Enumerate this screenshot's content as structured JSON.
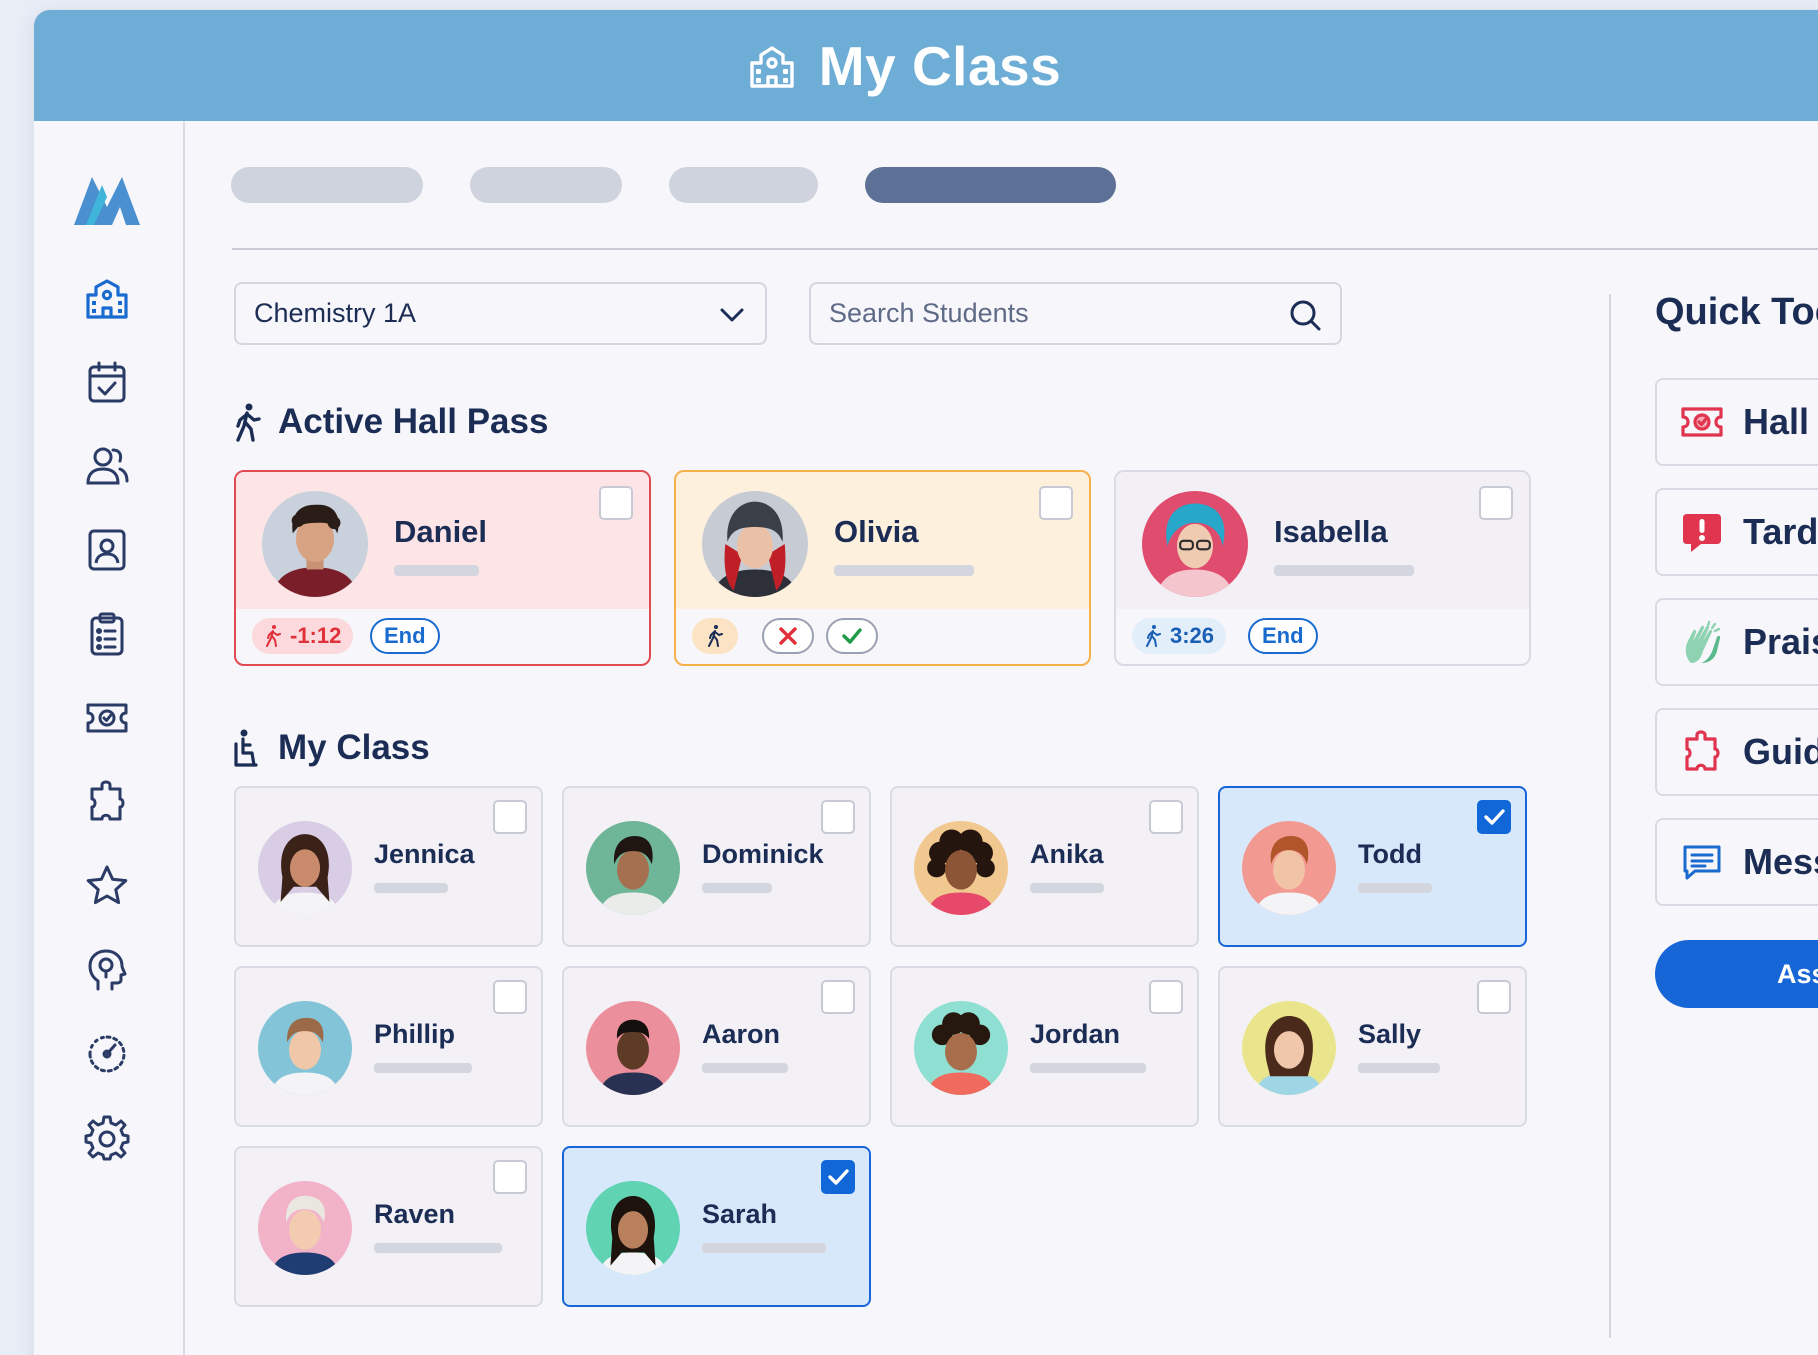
{
  "header": {
    "title": "My Class"
  },
  "sidebar": {
    "icons": [
      "logo-icon",
      "school-icon",
      "calendar-check-icon",
      "users-icon",
      "id-card-icon",
      "clipboard-icon",
      "ticket-icon",
      "puzzle-icon",
      "star-icon",
      "head-icon",
      "gauge-icon",
      "gear-icon"
    ]
  },
  "filters": {
    "class_value": "Chemistry 1A",
    "search_placeholder": "Search Students"
  },
  "hall_pass": {
    "title": "Active Hall Pass",
    "cards": [
      {
        "name": "Daniel",
        "status": "overdue",
        "time": "-1:12",
        "action": "End",
        "accent": "#e04a52"
      },
      {
        "name": "Olivia",
        "status": "pending",
        "accent": "#f5b04a"
      },
      {
        "name": "Isabella",
        "status": "active",
        "time": "3:26",
        "action": "End"
      }
    ]
  },
  "my_class": {
    "title": "My Class",
    "students": [
      {
        "name": "Jennica",
        "selected": false
      },
      {
        "name": "Dominick",
        "selected": false
      },
      {
        "name": "Anika",
        "selected": false
      },
      {
        "name": "Todd",
        "selected": true
      },
      {
        "name": "Phillip",
        "selected": false
      },
      {
        "name": "Aaron",
        "selected": false
      },
      {
        "name": "Jordan",
        "selected": false
      },
      {
        "name": "Sally",
        "selected": false
      },
      {
        "name": "Raven",
        "selected": false
      },
      {
        "name": "Sarah",
        "selected": true
      }
    ]
  },
  "quick_tools": {
    "title": "Quick Tool",
    "items": [
      {
        "label": "Hall Pa",
        "icon": "ticket-icon"
      },
      {
        "label": "Tardy",
        "icon": "alert-icon"
      },
      {
        "label": "Praise",
        "icon": "clap-icon"
      },
      {
        "label": "Guidar",
        "icon": "puzzle-icon"
      },
      {
        "label": "Messa",
        "icon": "message-icon"
      }
    ],
    "assign_label": "Assign"
  },
  "colors": {
    "header": "#6eadd6",
    "primary": "#1766d8",
    "navy": "#1b2d55",
    "danger": "#e04a52",
    "warning": "#f5b04a"
  }
}
